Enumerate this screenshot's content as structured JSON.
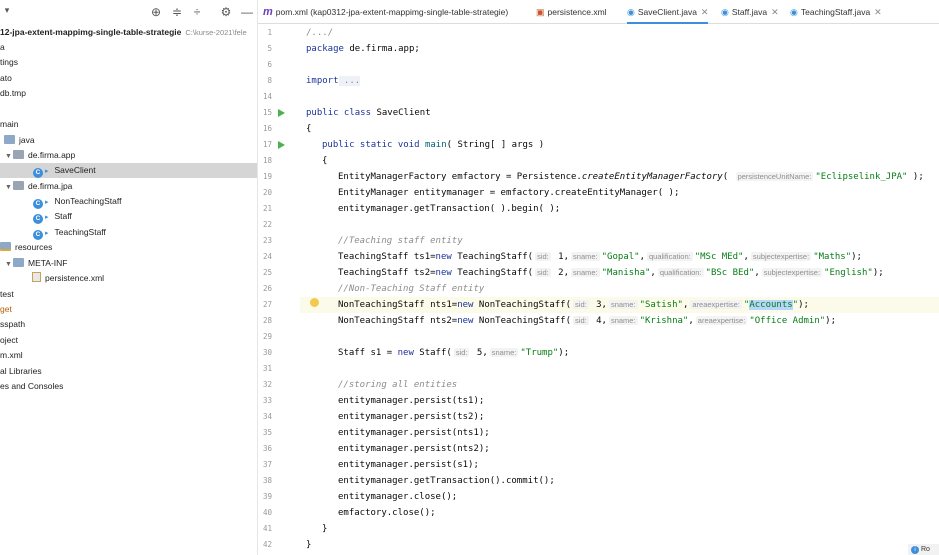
{
  "project_panel": {
    "toolbar_icons": [
      "target-icon",
      "expand-all-icon",
      "collapse-all-icon",
      "gear-icon",
      "minimize-icon"
    ],
    "tree": [
      {
        "label": "12-jpa-extent-mappimg-single-table-strategie",
        "sub": "C:\\kurse-2021\\fele",
        "bold": true
      },
      {
        "label": "a"
      },
      {
        "label": "tings"
      },
      {
        "label": "ato"
      },
      {
        "label": "db.tmp"
      },
      {
        "label": ""
      },
      {
        "label": "main"
      },
      {
        "label": "java"
      },
      {
        "label": "de.firma.app"
      },
      {
        "label": "SaveClient"
      },
      {
        "label": "de.firma.jpa"
      },
      {
        "label": "NonTeachingStaff"
      },
      {
        "label": "Staff"
      },
      {
        "label": "TeachingStaff"
      },
      {
        "label": "resources"
      },
      {
        "label": "META-INF"
      },
      {
        "label": "persistence.xml"
      },
      {
        "label": "test"
      },
      {
        "label": "get"
      },
      {
        "label": "sspath"
      },
      {
        "label": "oject"
      },
      {
        "label": "m.xml"
      },
      {
        "label": "al Libraries"
      },
      {
        "label": "es and Consoles"
      }
    ]
  },
  "tabs": [
    {
      "label": "pom.xml (kap0312-jpa-extent-mappimg-single-table-strategie)",
      "icon": "m"
    },
    {
      "label": "persistence.xml",
      "icon": "xml"
    },
    {
      "label": "SaveClient.java",
      "icon": "C"
    },
    {
      "label": "Staff.java",
      "icon": "C"
    },
    {
      "label": "TeachingStaff.java",
      "icon": "C"
    }
  ],
  "line_numbers": [
    "1",
    "5",
    "6",
    "8",
    "14",
    "15",
    "16",
    "17",
    "18",
    "19",
    "20",
    "21",
    "22",
    "23",
    "24",
    "25",
    "26",
    "27",
    "28",
    "29",
    "30",
    "31",
    "32",
    "33",
    "34",
    "35",
    "36",
    "37",
    "38",
    "39",
    "40",
    "41",
    "42"
  ],
  "code": {
    "l1": "/.../",
    "l5a": "package ",
    "l5b": "de.firma.app;",
    "l8a": "import",
    "l8b": " ...",
    "l15a": "public class ",
    "l15b": "SaveClient",
    "l16": "{",
    "l17a": "public static void ",
    "l17b": "main",
    "l17c": "( String[ ] args )",
    "l18": "{",
    "l19a": "EntityManagerFactory emfactory = Persistence.",
    "l19b": "createEntityManagerFactory",
    "l19c": "( ",
    "l19h": "persistenceUnitName:",
    "l19d": "\"Eclipselink_JPA\"",
    "l19e": " );",
    "l20": "EntityManager entitymanager = emfactory.createEntityManager( );",
    "l21": "entitymanager.getTransaction( ).begin( );",
    "l23": "//Teaching staff entity",
    "l24a": "TeachingStaff ts1=",
    "l24b": "new ",
    "l24c": "TeachingStaff(",
    "l24h1": "sid:",
    "l24d": " 1,",
    "l24h2": "sname:",
    "l24e": "\"Gopal\"",
    "l24f": ",",
    "l24h3": "qualification:",
    "l24g": "\"MSc MEd\"",
    "l24i": ",",
    "l24h4": "subjectexpertise:",
    "l24j": "\"Maths\"",
    "l24k": ");",
    "l25a": "TeachingStaff ts2=",
    "l25b": "new ",
    "l25c": "TeachingStaff(",
    "l25h1": "sid:",
    "l25d": " 2,",
    "l25h2": "sname:",
    "l25e": "\"Manisha\"",
    "l25f": ",",
    "l25h3": "qualification:",
    "l25g": "\"BSc BEd\"",
    "l25i": ",",
    "l25h4": "subjectexpertise:",
    "l25j": "\"English\"",
    "l25k": ");",
    "l26": "//Non-Teaching Staff entity",
    "l27a": "NonTeachingStaff nts1=",
    "l27b": "new ",
    "l27c": "NonTeachingStaff(",
    "l27h1": "sid:",
    "l27d": " 3,",
    "l27h2": "sname:",
    "l27e": "\"Satish\"",
    "l27f": ",",
    "l27h3": "areaexpertise:",
    "l27g1": "\"",
    "l27g2": "Accounts",
    "l27g3": "\"",
    "l27k": ");",
    "l28a": "NonTeachingStaff nts2=",
    "l28b": "new ",
    "l28c": "NonTeachingStaff(",
    "l28h1": "sid:",
    "l28d": " 4,",
    "l28h2": "sname:",
    "l28e": "\"Krishna\"",
    "l28f": ",",
    "l28h3": "areaexpertise:",
    "l28g": "\"Office Admin\"",
    "l28k": ");",
    "l30a": "Staff s1 = ",
    "l30b": "new ",
    "l30c": "Staff(",
    "l30h1": "sid:",
    "l30d": " 5,",
    "l30h2": "sname:",
    "l30e": "\"Trump\"",
    "l30k": ");",
    "l32": "//storing all entities",
    "l33": "entitymanager.persist(ts1);",
    "l34": "entitymanager.persist(ts2);",
    "l35": "entitymanager.persist(nts1);",
    "l36": "entitymanager.persist(nts2);",
    "l37": "entitymanager.persist(s1);",
    "l38": "entitymanager.getTransaction().commit();",
    "l39": "entitymanager.close();",
    "l40": "emfactory.close();",
    "l41": "}",
    "l42": "}"
  },
  "notification": {
    "label": "Ro"
  }
}
